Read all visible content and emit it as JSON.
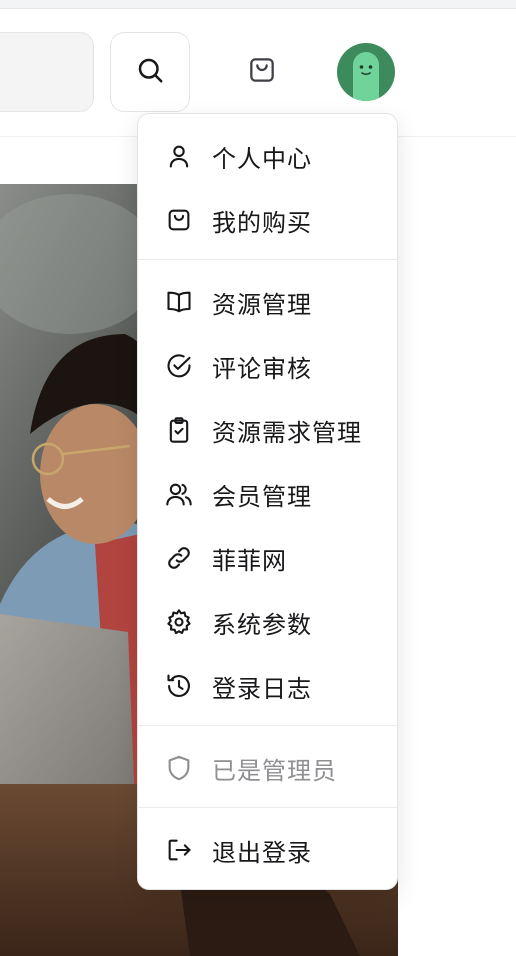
{
  "header": {
    "search_icon": "search-icon",
    "cart_icon": "shopping-bag-icon",
    "avatar_icon": "robot-avatar-icon"
  },
  "menu": {
    "items": [
      {
        "label": "个人中心",
        "icon": "user-icon"
      },
      {
        "label": "我的购买",
        "icon": "shopping-bag-icon"
      },
      {
        "label": "资源管理",
        "icon": "book-open-icon"
      },
      {
        "label": "评论审核",
        "icon": "check-circle-icon"
      },
      {
        "label": "资源需求管理",
        "icon": "clipboard-check-icon"
      },
      {
        "label": "会员管理",
        "icon": "users-icon"
      },
      {
        "label": "菲菲网",
        "icon": "link-icon"
      },
      {
        "label": "系统参数",
        "icon": "gear-icon"
      },
      {
        "label": "登录日志",
        "icon": "history-icon"
      },
      {
        "label": "已是管理员",
        "icon": "shield-icon"
      },
      {
        "label": "退出登录",
        "icon": "logout-icon"
      }
    ]
  },
  "colors": {
    "accent": "#3d8a5c",
    "avatar_face": "#6fd39a",
    "text": "#18181b",
    "muted": "#8e8e93"
  }
}
